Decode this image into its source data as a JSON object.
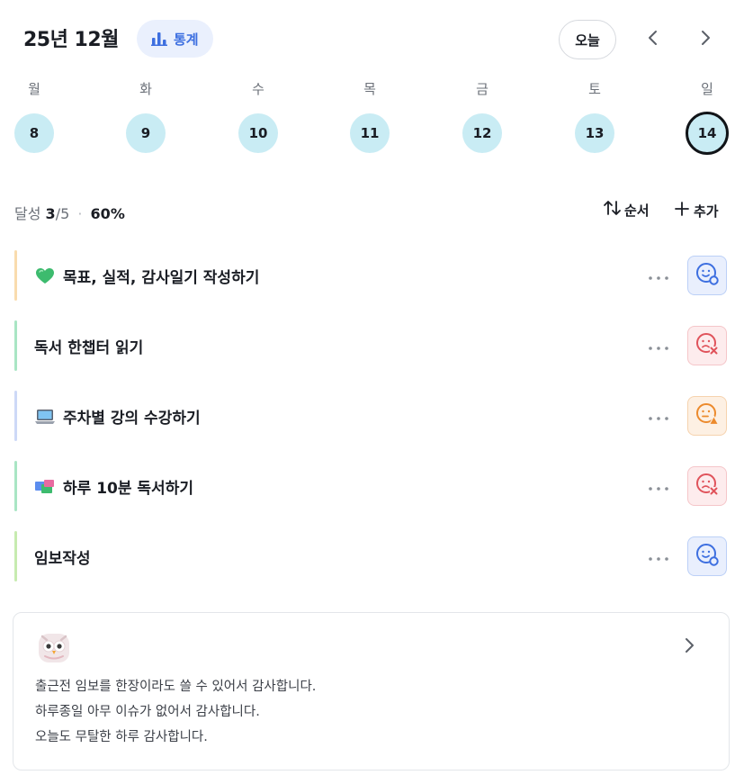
{
  "header": {
    "month_title": "25년 12월",
    "stats_label": "통계",
    "today_label": "오늘",
    "prev_icon": "chevron-left-icon",
    "next_icon": "chevron-right-icon"
  },
  "week": {
    "days": [
      {
        "label": "월",
        "date": "8",
        "selected": false
      },
      {
        "label": "화",
        "date": "9",
        "selected": false
      },
      {
        "label": "수",
        "date": "10",
        "selected": false
      },
      {
        "label": "목",
        "date": "11",
        "selected": false
      },
      {
        "label": "금",
        "date": "12",
        "selected": false
      },
      {
        "label": "토",
        "date": "13",
        "selected": false
      },
      {
        "label": "일",
        "date": "14",
        "selected": true
      }
    ]
  },
  "summary": {
    "label": "달성",
    "done": "3",
    "total": "/5",
    "separator": "·",
    "percent": "60%",
    "order_label": "순서",
    "add_label": "추가"
  },
  "tasks": [
    {
      "title": "목표, 실적, 감사일기 작성하기",
      "emoji": "green-heart-icon",
      "bar_color": "#f9dcae",
      "status": "smile",
      "status_icon": "smile-check-icon"
    },
    {
      "title": "독서 한챕터 읽기",
      "emoji": "",
      "bar_color": "#a9e5c4",
      "status": "fail",
      "status_icon": "sad-x-icon"
    },
    {
      "title": "주차별 강의 수강하기",
      "emoji": "laptop-icon",
      "bar_color": "#cdd9f7",
      "status": "warn",
      "status_icon": "meh-warning-icon"
    },
    {
      "title": "하루 10분 독서하기",
      "emoji": "books-icon",
      "bar_color": "#a9e5c4",
      "status": "fail",
      "status_icon": "sad-x-icon"
    },
    {
      "title": "임보작성",
      "emoji": "",
      "bar_color": "#c7ebb0",
      "status": "smile",
      "status_icon": "smile-check-icon"
    }
  ],
  "status_colors": {
    "smile": {
      "bg": "#e9effd",
      "border": "#bcd0f7",
      "fg": "#3d6fe0"
    },
    "fail": {
      "bg": "#fdeced",
      "border": "#f5c6c9",
      "fg": "#e0535b"
    },
    "warn": {
      "bg": "#fdf0e3",
      "border": "#f6d3ae",
      "fg": "#ec8a2c"
    }
  },
  "gratitude": {
    "icon": "owl-icon",
    "lines": [
      "출근전 임보를 한장이라도 쓸 수 있어서 감사합니다.",
      "하루종일 아무 이슈가 없어서 감사합니다.",
      "오늘도 무탈한 하루 감사합니다."
    ]
  },
  "accent": "#3d6fe0",
  "day_circle_color": "#c9ecf4"
}
